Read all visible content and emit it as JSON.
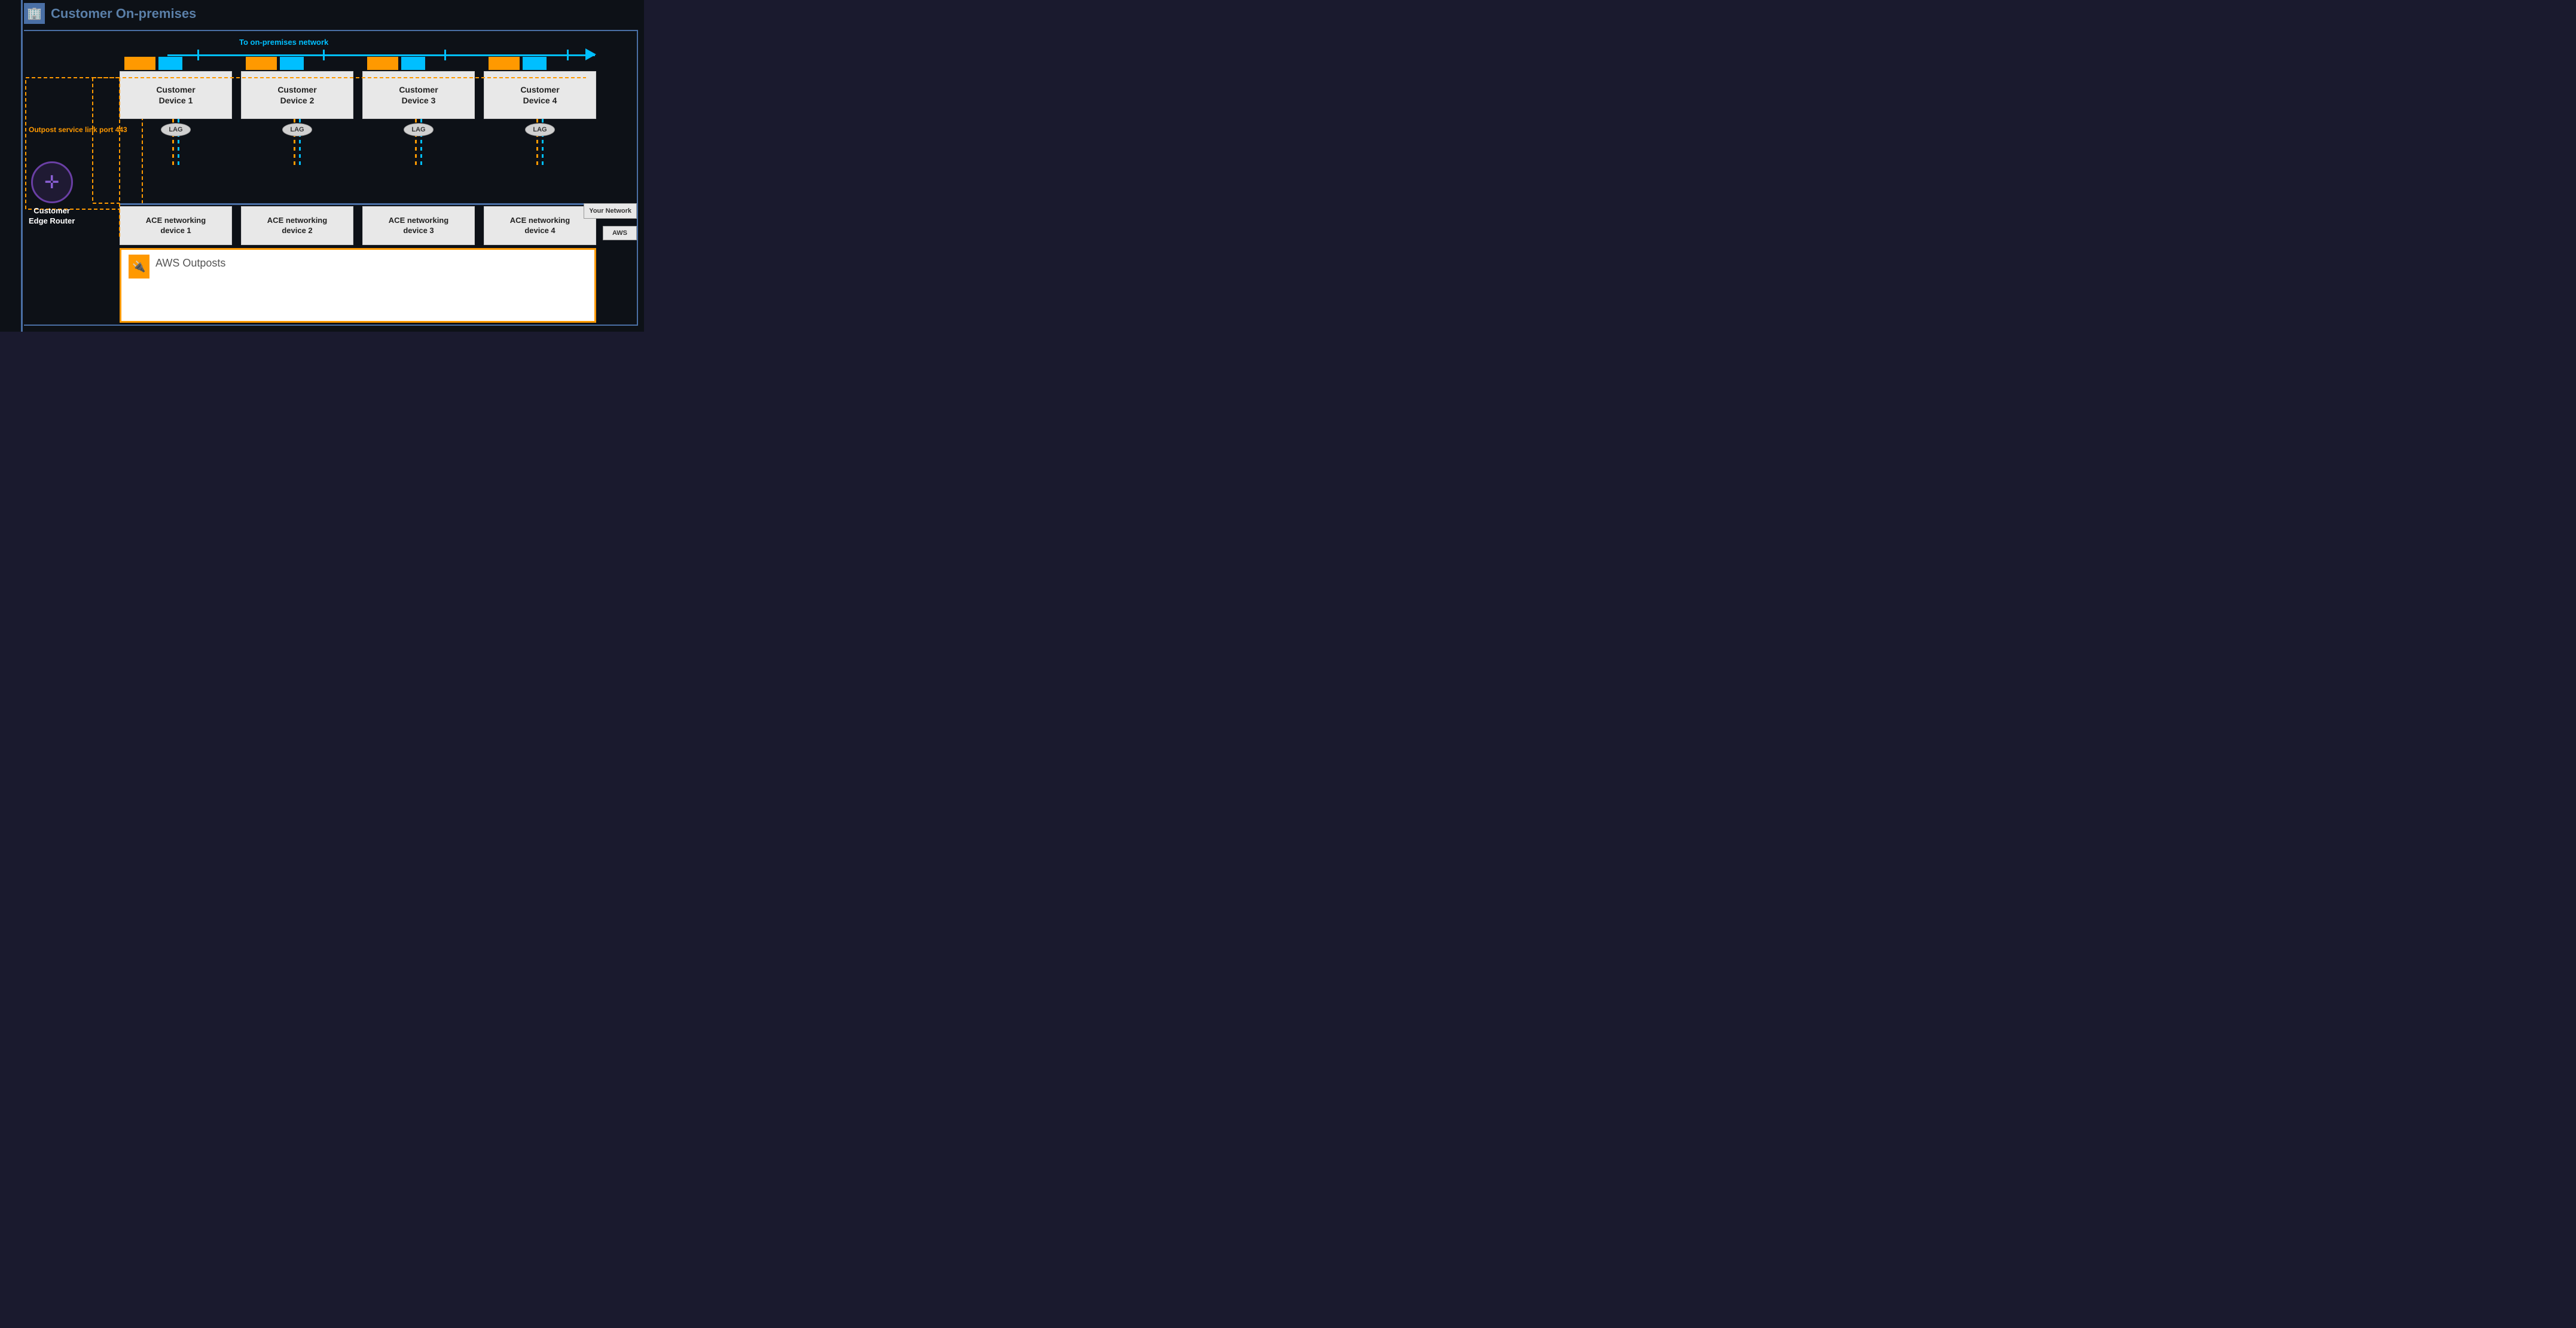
{
  "header": {
    "title": "Customer On-premises",
    "building_icon": "🏢"
  },
  "arrow": {
    "label": "To on-premises network"
  },
  "service_link": {
    "label": "Outpost service link\nport 443"
  },
  "edge_router": {
    "label": "Customer\nEdge Router"
  },
  "customer_devices": [
    {
      "name": "Customer\nDevice 1"
    },
    {
      "name": "Customer\nDevice 2"
    },
    {
      "name": "Customer\nDevice 3"
    },
    {
      "name": "Customer\nDevice 4"
    }
  ],
  "lag_label": "LAG",
  "ace_devices": [
    {
      "name": "ACE networking\ndevice 1"
    },
    {
      "name": "ACE networking\ndevice 2"
    },
    {
      "name": "ACE networking\ndevice 3"
    },
    {
      "name": "ACE networking\ndevice 4"
    }
  ],
  "your_network": {
    "label": "Your\nNetwork"
  },
  "aws_label": "AWS",
  "outposts": {
    "label": "AWS Outposts",
    "icon": "🔌"
  },
  "colors": {
    "cyan": "#00bfff",
    "orange": "#ff9900",
    "purple": "#6a3fa5",
    "dark_bg": "#0d1117",
    "device_bg": "#e8e8e8",
    "sidebar": "#4a6fa5"
  }
}
